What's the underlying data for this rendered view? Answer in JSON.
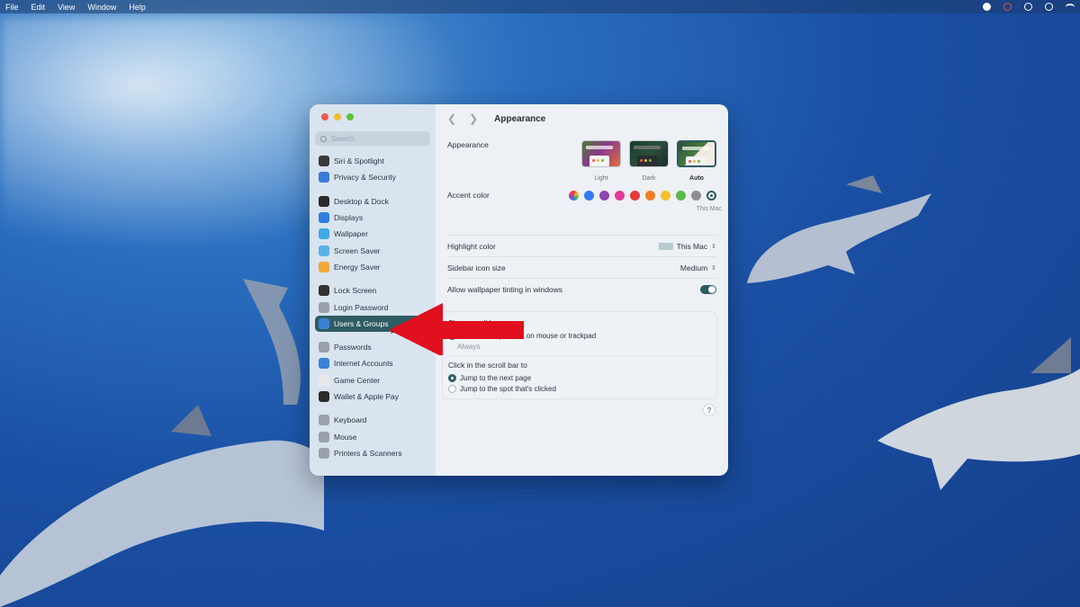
{
  "menubar": {
    "items": [
      "File",
      "Edit",
      "View",
      "Window",
      "Help"
    ]
  },
  "sidebar": {
    "search_placeholder": "Search",
    "groups": [
      [
        {
          "label": "Siri & Spotlight",
          "icon": "siri-icon",
          "color": "#3b3b3b"
        },
        {
          "label": "Privacy & Security",
          "icon": "hand-icon",
          "color": "#3a7bd5"
        }
      ],
      [
        {
          "label": "Desktop & Dock",
          "icon": "dock-icon",
          "color": "#2b2b2b"
        },
        {
          "label": "Displays",
          "icon": "sun-icon",
          "color": "#2f7fe0"
        },
        {
          "label": "Wallpaper",
          "icon": "flower-icon",
          "color": "#3fa9e8"
        },
        {
          "label": "Screen Saver",
          "icon": "screensaver-icon",
          "color": "#5ab3e6"
        },
        {
          "label": "Energy Saver",
          "icon": "battery-icon",
          "color": "#f2a83b"
        }
      ],
      [
        {
          "label": "Lock Screen",
          "icon": "lock-icon",
          "color": "#333333"
        },
        {
          "label": "Login Password",
          "icon": "key-icon",
          "color": "#9aa1a9"
        },
        {
          "label": "Users & Groups",
          "icon": "users-icon",
          "color": "#3b82d6",
          "selected": true
        }
      ],
      [
        {
          "label": "Passwords",
          "icon": "passwords-icon",
          "color": "#9aa1a9"
        },
        {
          "label": "Internet Accounts",
          "icon": "at-icon",
          "color": "#3b82d6"
        },
        {
          "label": "Game Center",
          "icon": "game-center-icon",
          "color": "#e9e9e9"
        },
        {
          "label": "Wallet & Apple Pay",
          "icon": "wallet-icon",
          "color": "#2b2b2b"
        }
      ],
      [
        {
          "label": "Keyboard",
          "icon": "keyboard-icon",
          "color": "#9aa1a9"
        },
        {
          "label": "Mouse",
          "icon": "mouse-icon",
          "color": "#9aa1a9"
        },
        {
          "label": "Printers & Scanners",
          "icon": "printer-icon",
          "color": "#9aa1a9"
        }
      ]
    ]
  },
  "main": {
    "title": "Appearance",
    "appearance_label": "Appearance",
    "modes": [
      {
        "label": "Light",
        "selected": false
      },
      {
        "label": "Dark",
        "selected": false
      },
      {
        "label": "Auto",
        "selected": true
      }
    ],
    "accent_label": "Accent color",
    "accent_colors": [
      "multicolor",
      "#3478f6",
      "#8e44ad",
      "#e5399a",
      "#e5393a",
      "#f07d22",
      "#f5c02e",
      "#5cb84a",
      "#8e8e93",
      "#2e5c63"
    ],
    "accent_caption": "This Mac",
    "highlight_label": "Highlight color",
    "highlight_value": "This Mac",
    "sidebar_size_label": "Sidebar icon size",
    "sidebar_size_value": "Medium",
    "tinting_label": "Allow wallpaper tinting in windows",
    "scroll_bars_title": "Show scroll bars",
    "scroll_opt_auto": "Automatically based on mouse or trackpad",
    "scroll_opt_always": "Always",
    "click_title": "Click in the scroll bar to",
    "click_opt_next": "Jump to the next page",
    "click_opt_spot": "Jump to the spot that's clicked",
    "help": "?"
  }
}
